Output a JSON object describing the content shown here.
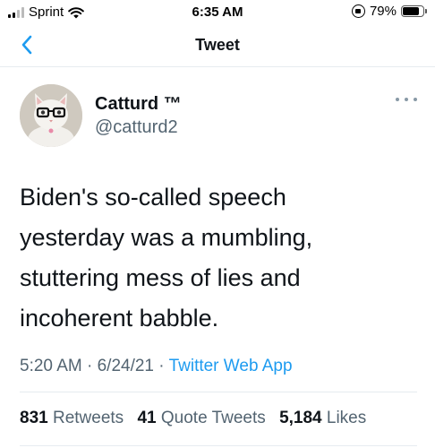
{
  "status_bar": {
    "carrier": "Sprint",
    "time": "6:35 AM",
    "battery_percent": "79%",
    "battery_level": 0.79
  },
  "header": {
    "title": "Tweet"
  },
  "tweet": {
    "author_name": "Catturd ™",
    "author_handle": "@catturd2",
    "text_lines": [
      "Biden's so-called speech",
      "yesterday was a mumbling,",
      "stuttering mess of lies and",
      "incoherent babble."
    ],
    "time": "5:20 AM",
    "date": "6/24/21",
    "separator": "·",
    "source": "Twitter Web App",
    "stats": {
      "retweets_count": "831",
      "retweets_label": "Retweets",
      "quotes_count": "41",
      "quotes_label": "Quote Tweets",
      "likes_count": "5,184",
      "likes_label": "Likes"
    }
  },
  "colors": {
    "accent": "#1d9bf0",
    "secondary_text": "#536471",
    "divider": "#e6ecf0"
  },
  "icons": {
    "back": "chevron-left-icon",
    "more": "more-horizontal-icon"
  }
}
